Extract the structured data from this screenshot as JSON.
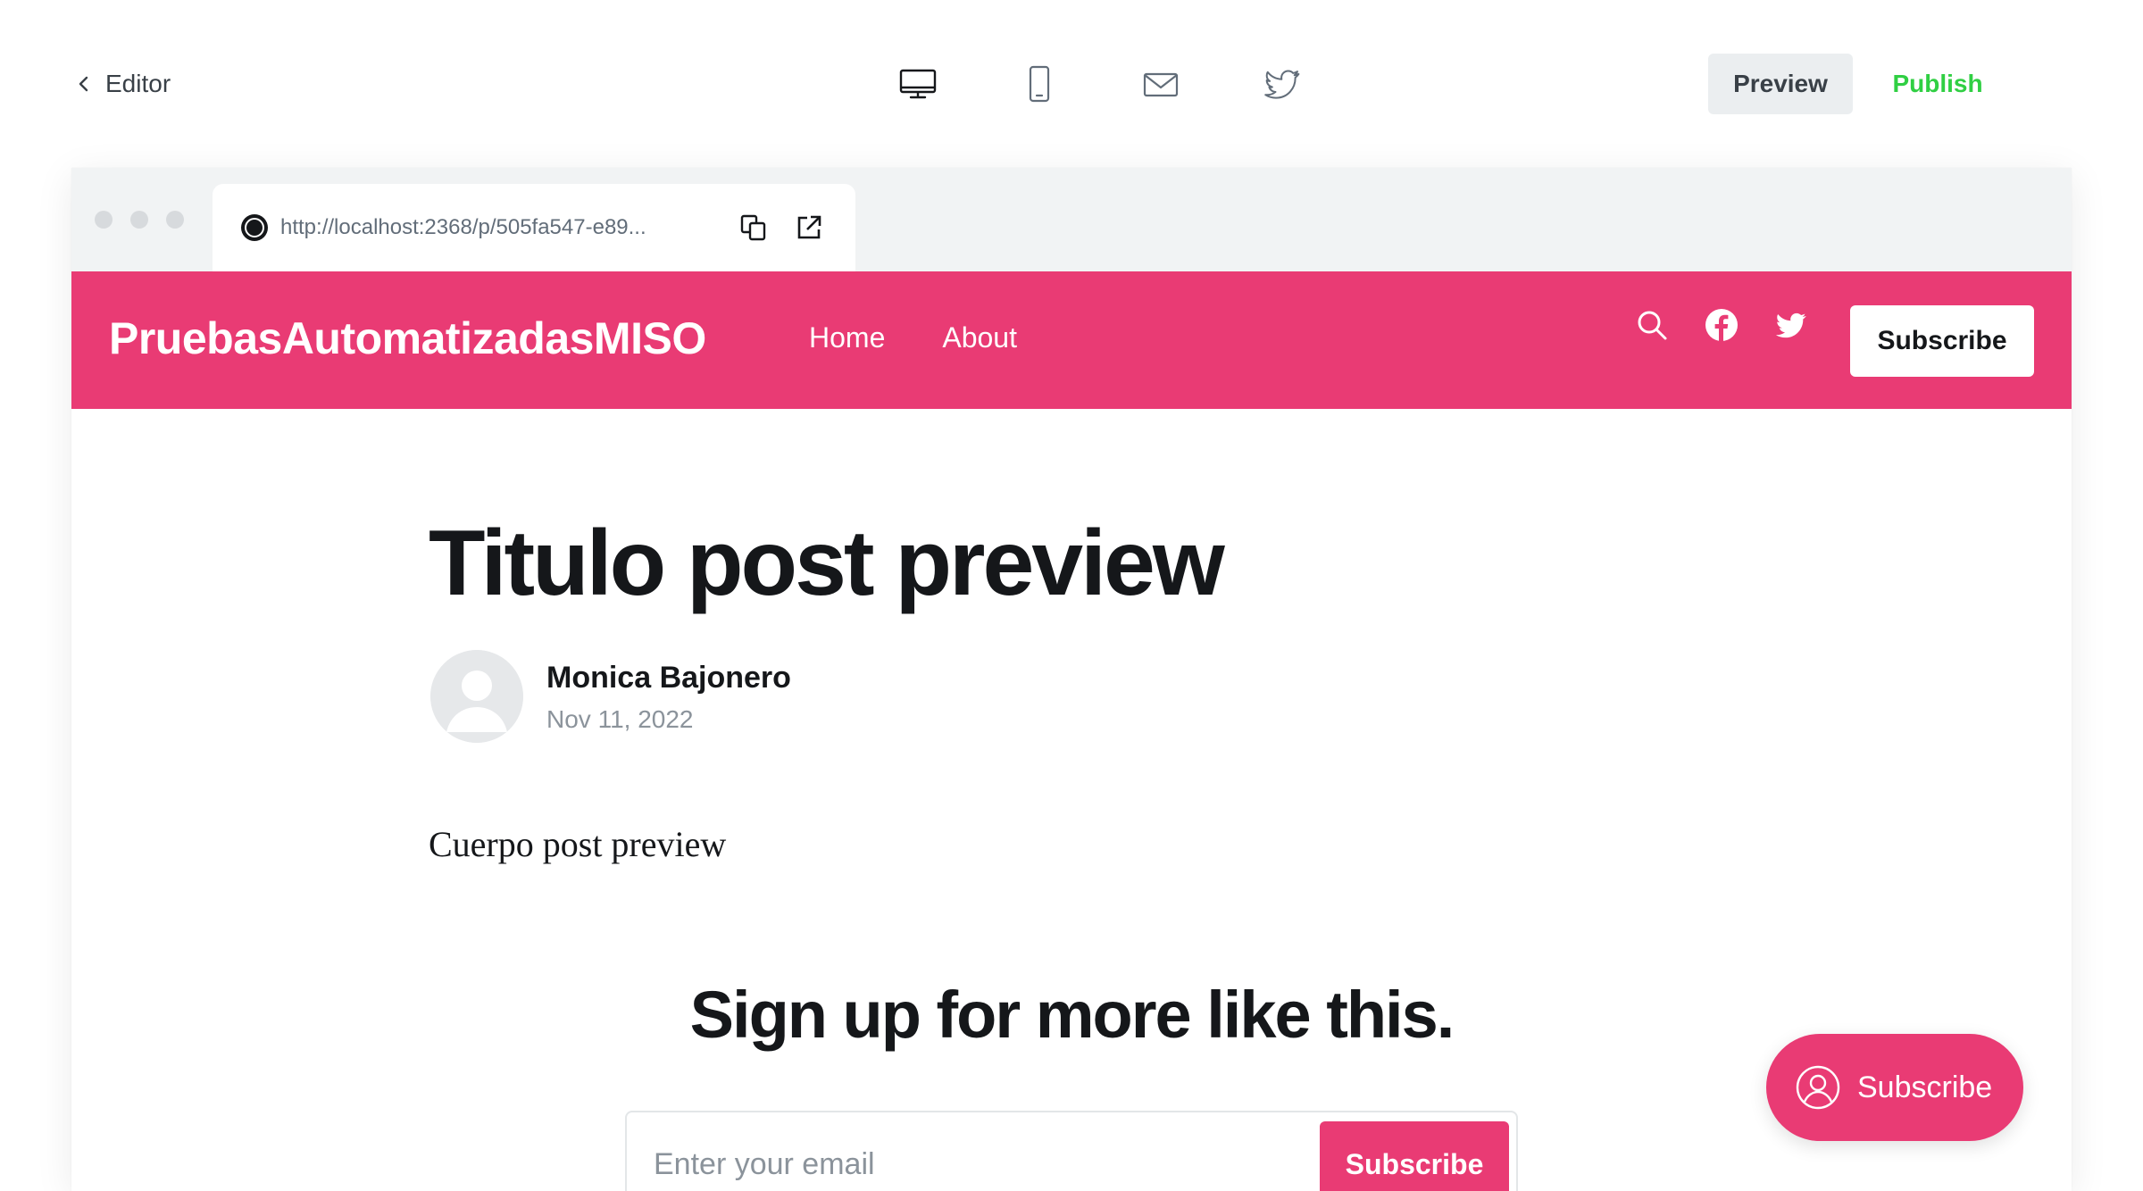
{
  "editor": {
    "back_label": "Editor",
    "preview_label": "Preview",
    "publish_label": "Publish",
    "publish_color": "#30cf43",
    "device_modes": [
      {
        "name": "desktop",
        "icon": "desktop-icon",
        "active": true
      },
      {
        "name": "mobile",
        "icon": "mobile-icon",
        "active": false
      },
      {
        "name": "email",
        "icon": "mail-icon",
        "active": false
      },
      {
        "name": "twitter",
        "icon": "twitter-icon",
        "active": false
      }
    ]
  },
  "browser": {
    "url": "http://localhost:2368/p/505fa547-e89..."
  },
  "site": {
    "accent_color": "#e93b74",
    "title": "PruebasAutomatizadasMISO",
    "nav": [
      {
        "label": "Home"
      },
      {
        "label": "About"
      }
    ],
    "header_subscribe_label": "Subscribe"
  },
  "post": {
    "title": "Titulo post preview",
    "author": "Monica Bajonero",
    "date": "Nov 11, 2022",
    "body": "Cuerpo post preview"
  },
  "signup": {
    "heading": "Sign up for more like this.",
    "email_placeholder": "Enter your email",
    "button_label": "Subscribe"
  },
  "floating_subscribe": {
    "label": "Subscribe"
  }
}
